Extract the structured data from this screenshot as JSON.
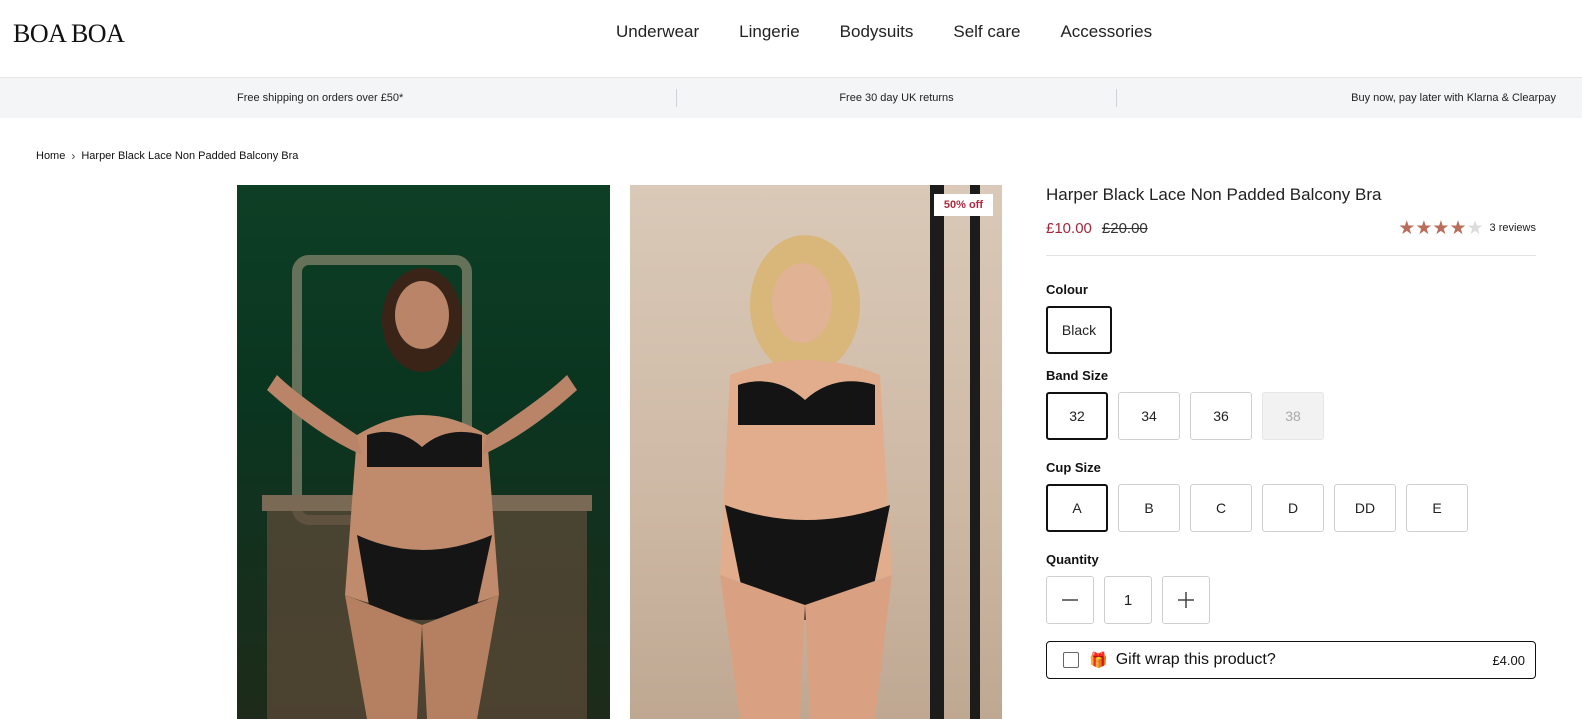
{
  "header": {
    "logo": "BOA BOA",
    "nav": [
      "Underwear",
      "Lingerie",
      "Bodysuits",
      "Self care",
      "Accessories"
    ]
  },
  "promo": [
    "Free shipping on orders over £50*",
    "Free 30 day UK returns",
    "Buy now, pay later with Klarna & Clearpay"
  ],
  "breadcrumb": {
    "home": "Home",
    "current": "Harper Black Lace Non Padded Balcony Bra"
  },
  "gallery": {
    "badge": "50% off"
  },
  "product": {
    "title": "Harper Black Lace Non Padded Balcony Bra",
    "price": "£10.00",
    "compare_price": "£20.00",
    "rating": 4,
    "rating_max": 5,
    "reviews": "3 reviews",
    "colour_label": "Colour",
    "colours": [
      "Black"
    ],
    "band_label": "Band Size",
    "bands": [
      "32",
      "34",
      "36",
      "38"
    ],
    "cup_label": "Cup Size",
    "cups": [
      "A",
      "B",
      "C",
      "D",
      "DD",
      "E"
    ],
    "quantity_label": "Quantity",
    "quantity": "1",
    "gift_label": "Gift wrap this product?",
    "gift_price": "£4.00"
  },
  "colors": {
    "accent": "#a3283c",
    "star": "#b96d5b"
  }
}
